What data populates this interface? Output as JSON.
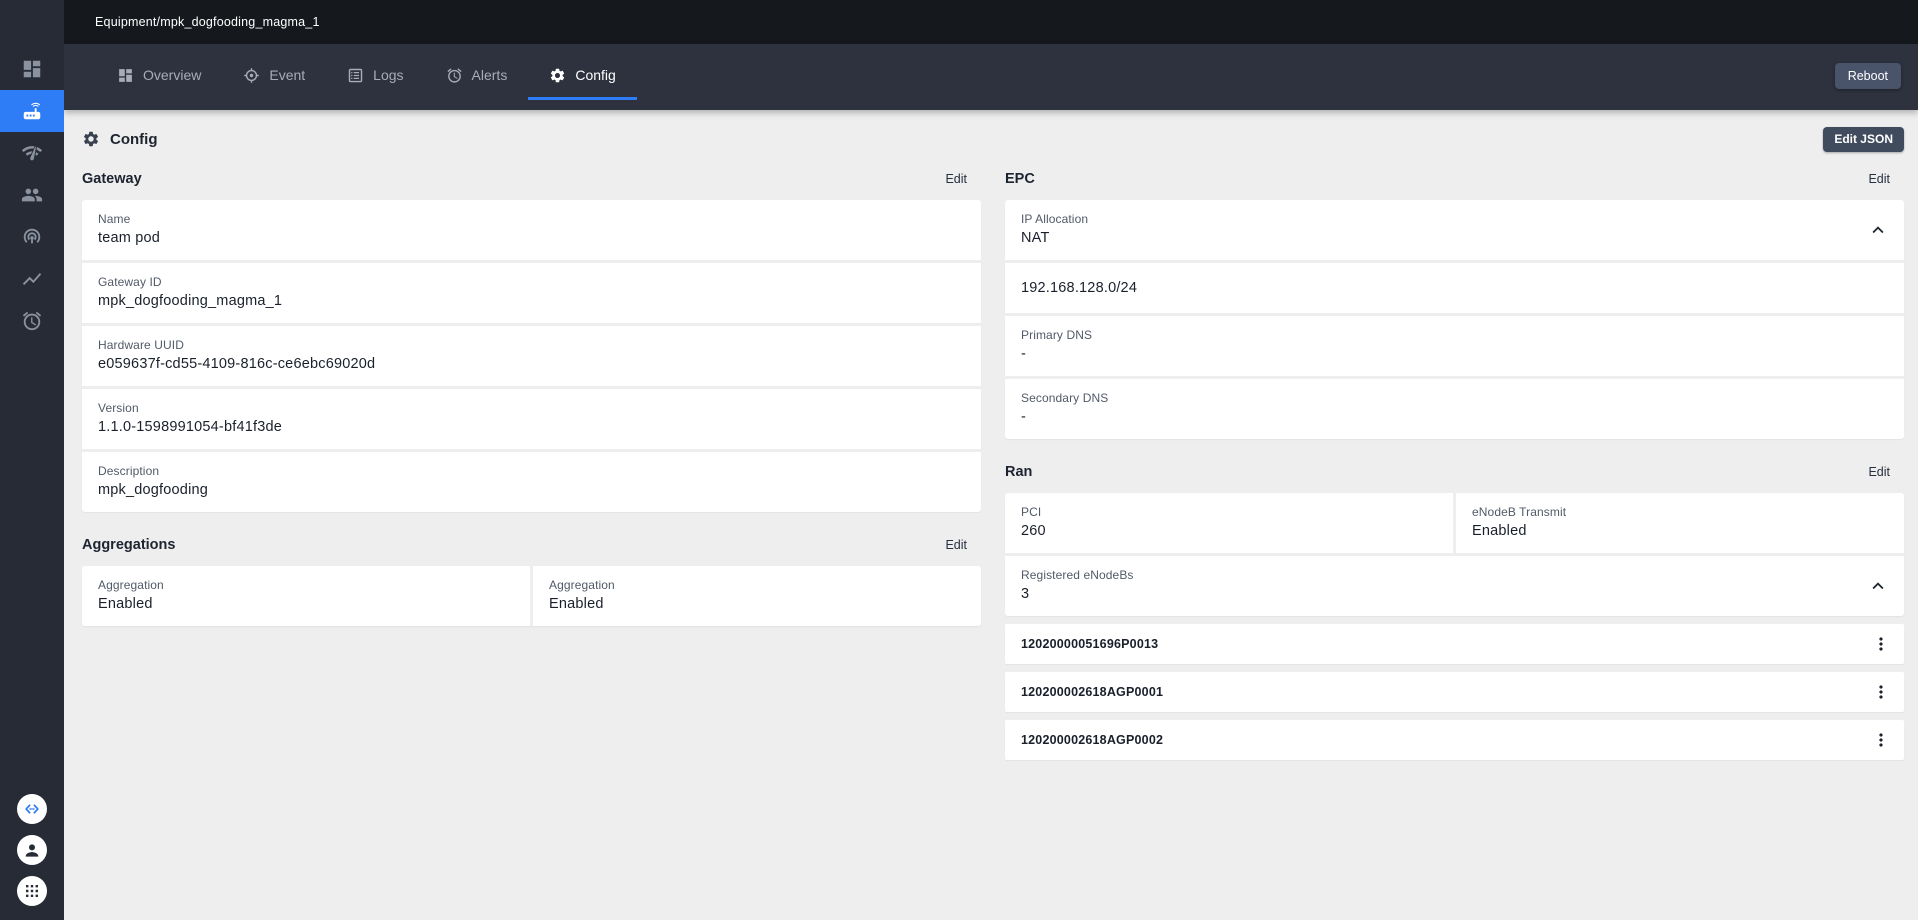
{
  "header": {
    "breadcrumb": "Equipment/mpk_dogfooding_magma_1",
    "reboot_label": "Reboot"
  },
  "tabs": [
    {
      "label": "Overview",
      "icon": "dashboard-icon",
      "active": false
    },
    {
      "label": "Event",
      "icon": "my-location-icon",
      "active": false
    },
    {
      "label": "Logs",
      "icon": "list-alt-icon",
      "active": false
    },
    {
      "label": "Alerts",
      "icon": "alarm-icon",
      "active": false
    },
    {
      "label": "Config",
      "icon": "settings-icon",
      "active": true
    }
  ],
  "sidebar": {
    "items": [
      {
        "icon": "dashboard-icon",
        "active": false
      },
      {
        "icon": "router-icon",
        "active": true
      },
      {
        "icon": "network-check-icon",
        "active": false
      },
      {
        "icon": "people-icon",
        "active": false
      },
      {
        "icon": "wifi-tethering-icon",
        "active": false
      },
      {
        "icon": "metrics-chart-icon",
        "active": false
      },
      {
        "icon": "alarm-icon",
        "active": false
      }
    ],
    "footer_items": [
      {
        "icon": "swagger-api-icon"
      },
      {
        "icon": "account-icon"
      },
      {
        "icon": "apps-grid-icon"
      }
    ]
  },
  "page": {
    "title": "Config",
    "title_icon": "settings-icon",
    "edit_json_label": "Edit JSON"
  },
  "gateway": {
    "title": "Gateway",
    "edit_label": "Edit",
    "fields": [
      {
        "label": "Name",
        "value": "team pod"
      },
      {
        "label": "Gateway ID",
        "value": "mpk_dogfooding_magma_1"
      },
      {
        "label": "Hardware UUID",
        "value": "e059637f-cd55-4109-816c-ce6ebc69020d"
      },
      {
        "label": "Version",
        "value": "1.1.0-1598991054-bf41f3de"
      },
      {
        "label": "Description",
        "value": "mpk_dogfooding"
      }
    ]
  },
  "aggregations": {
    "title": "Aggregations",
    "edit_label": "Edit",
    "fields": [
      {
        "label": "Aggregation",
        "value": "Enabled"
      },
      {
        "label": "Aggregation",
        "value": "Enabled"
      }
    ]
  },
  "epc": {
    "title": "EPC",
    "edit_label": "Edit",
    "ip_allocation": {
      "label": "IP Allocation",
      "value": "NAT"
    },
    "subnet": "192.168.128.0/24",
    "primary_dns": {
      "label": "Primary DNS",
      "value": "-"
    },
    "secondary_dns": {
      "label": "Secondary DNS",
      "value": "-"
    }
  },
  "ran": {
    "title": "Ran",
    "edit_label": "Edit",
    "pci": {
      "label": "PCI",
      "value": "260"
    },
    "enodeb_transmit": {
      "label": "eNodeB Transmit",
      "value": "Enabled"
    },
    "registered": {
      "label": "Registered eNodeBs",
      "value": "3"
    },
    "enodebs": [
      "12020000051696P0013",
      "120200002618AGP0001",
      "120200002618AGP0002"
    ]
  },
  "colors": {
    "accent_blue": "#2e7cf6",
    "topbar_bg": "#15181d",
    "tabbar_bg": "#2d323e",
    "sidebar_bg": "#262b35",
    "page_bg": "#eeeeee",
    "card_bg": "#ffffff",
    "reboot_bg": "#49546a",
    "edit_json_bg": "#414b5e"
  }
}
